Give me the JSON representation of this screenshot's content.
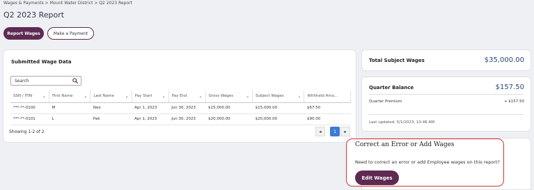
{
  "breadcrumb": "Wages & Payments > Mount Water District > Q2 2023 Report",
  "page_title": "Q2 2023 Report",
  "actions": {
    "report_wages": "Report Wages",
    "make_payment": "Make a Payment"
  },
  "wage_data": {
    "title": "Submitted Wage Data",
    "search_placeholder": "Search",
    "columns": [
      "SSN / ITIN",
      "First Name",
      "Last Name",
      "Pay Start",
      "Pay End",
      "Gross Wages",
      "Subject Wages",
      "Withheld Amo..."
    ],
    "rows": [
      [
        "***-**-0100",
        "M",
        "Neo",
        "Apr 1, 2023",
        "Jun 30, 2023",
        "$15,000.00",
        "$15,000.00",
        "$67.50"
      ],
      [
        "***-**-0101",
        "L",
        "Pak",
        "Apr 1, 2023",
        "Jun 30, 2023",
        "$20,000.00",
        "$20,000.00",
        "$90.00"
      ]
    ],
    "showing": "Showing 1-2 of 2",
    "pagination": {
      "prev": "◂",
      "current": "1",
      "next": "▸"
    }
  },
  "total_subject_wages": {
    "label": "Total Subject Wages",
    "value": "$35,000.00"
  },
  "quarter_balance": {
    "label": "Quarter Balance",
    "value": "$157.50",
    "premium_label": "Quarter Premium",
    "premium_value": "+ $157.50",
    "last_updated": "Last updated: 5/1/2023, 10:46 AM"
  },
  "correction": {
    "title": "Correct an Error or Add Wages",
    "description": "Need to correct an error or add Employee wages on this report?",
    "button": "Edit Wages"
  },
  "colors": {
    "brand": "#5e2a52",
    "balance_value": "#2c4a75",
    "highlight_outline": "#d93030",
    "page_active": "#3a7bd5"
  }
}
